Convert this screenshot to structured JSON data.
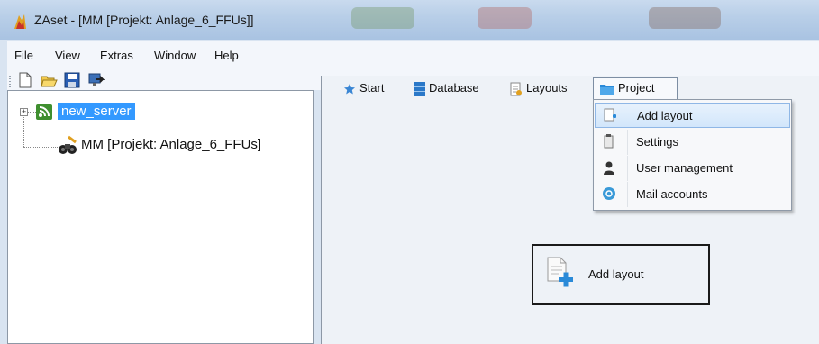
{
  "window": {
    "title": "ZAset - [MM [Projekt: Anlage_6_FFUs]]"
  },
  "menubar": {
    "items": [
      "File",
      "View",
      "Extras",
      "Window",
      "Help"
    ]
  },
  "toolbar": {
    "buttons": [
      "new-file-icon",
      "open-folder-icon",
      "save-icon",
      "connect-icon"
    ]
  },
  "tree": {
    "nodes": [
      {
        "label": "new_server",
        "icon": "server-rss-icon",
        "selected": true,
        "expander": "+"
      },
      {
        "label": "MM [Projekt: Anlage_6_FFUs]",
        "icon": "binoculars-icon"
      }
    ]
  },
  "tabs": [
    {
      "label": "Start",
      "icon": "star-icon"
    },
    {
      "label": "Database",
      "icon": "database-icon"
    },
    {
      "label": "Layouts",
      "icon": "layouts-icon"
    },
    {
      "label": "Project",
      "icon": "folder-icon",
      "active": true
    }
  ],
  "project_menu": {
    "items": [
      {
        "label": "Add layout",
        "icon": "add-layout-icon",
        "highlighted": true
      },
      {
        "label": "Settings",
        "icon": "settings-icon"
      },
      {
        "label": "User management",
        "icon": "user-icon"
      },
      {
        "label": "Mail accounts",
        "icon": "mail-icon"
      }
    ]
  },
  "main_button": {
    "label": "Add layout",
    "icon": "add-layout-icon"
  },
  "colors": {
    "selection": "#3399ff",
    "menu_highlight": "#d2e6fb",
    "titlebar": "#b9cfe8"
  }
}
